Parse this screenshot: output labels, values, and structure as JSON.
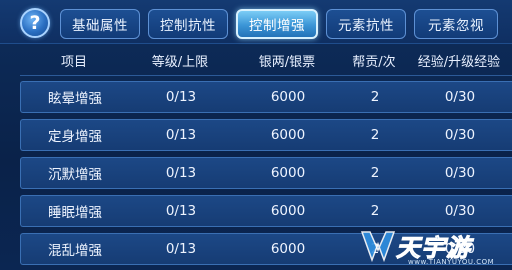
{
  "help_glyph": "?",
  "tabs": [
    {
      "label": "基础属性",
      "active": false
    },
    {
      "label": "控制抗性",
      "active": false
    },
    {
      "label": "控制增强",
      "active": true
    },
    {
      "label": "元素抗性",
      "active": false
    },
    {
      "label": "元素忽视",
      "active": false
    }
  ],
  "table": {
    "headers": [
      "项目",
      "等级/上限",
      "银两/银票",
      "帮贡/次",
      "经验/升级经验"
    ],
    "rows": [
      [
        "眩晕增强",
        "0/13",
        "6000",
        "2",
        "0/30"
      ],
      [
        "定身增强",
        "0/13",
        "6000",
        "2",
        "0/30"
      ],
      [
        "沉默增强",
        "0/13",
        "6000",
        "2",
        "0/30"
      ],
      [
        "睡眠增强",
        "0/13",
        "6000",
        "2",
        "0/30"
      ],
      [
        "混乱增强",
        "0/13",
        "6000",
        "2",
        "0/30"
      ]
    ]
  },
  "watermark": {
    "text": "天宇游",
    "url": "www.TIANYUYOU.COM"
  },
  "colors": {
    "background": "#0b2650",
    "tab": "#123b78",
    "tab_active": "#3b95d6",
    "row": "#163c74"
  }
}
